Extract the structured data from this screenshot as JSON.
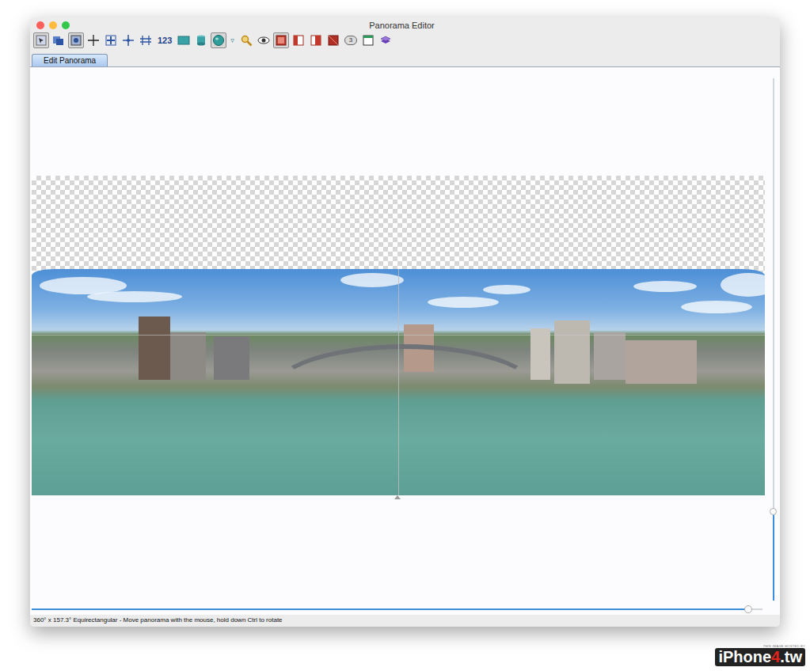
{
  "window": {
    "title": "Panorama Editor"
  },
  "toolbar": [
    {
      "kind": "icon",
      "selected": true
    },
    {
      "kind": "icon",
      "selected": false
    },
    {
      "kind": "icon",
      "selected": true
    },
    {
      "kind": "icon",
      "selected": false
    },
    {
      "kind": "icon",
      "selected": false
    },
    {
      "kind": "icon",
      "selected": false
    },
    {
      "kind": "icon",
      "selected": false
    },
    {
      "kind": "text",
      "label": "123",
      "selected": false
    },
    {
      "kind": "icon",
      "selected": false
    },
    {
      "kind": "icon",
      "selected": false
    },
    {
      "kind": "icon",
      "selected": true
    },
    {
      "kind": "text",
      "label": "▿",
      "selected": false
    },
    {
      "kind": "icon",
      "selected": false
    },
    {
      "kind": "icon",
      "selected": false
    },
    {
      "kind": "icon",
      "selected": true
    },
    {
      "kind": "icon",
      "selected": false
    },
    {
      "kind": "icon",
      "selected": false
    },
    {
      "kind": "icon",
      "selected": false
    },
    {
      "kind": "badge",
      "label": "3",
      "selected": false
    },
    {
      "kind": "icon",
      "selected": false
    },
    {
      "kind": "icon",
      "selected": false
    }
  ],
  "tabs": [
    {
      "label": "Edit Panorama",
      "selected": true
    }
  ],
  "zoom_slider": {
    "level": 0.17
  },
  "pan_slider": {
    "level": 0.98
  },
  "status_bar": "360° x 157.3° Equirectangular - Move panorama with the mouse, hold down Ctrl to rotate",
  "watermark": {
    "caption": "THIS IMAGE HOSTED BY",
    "parts": [
      "iPhone",
      "4",
      ".tw"
    ]
  }
}
